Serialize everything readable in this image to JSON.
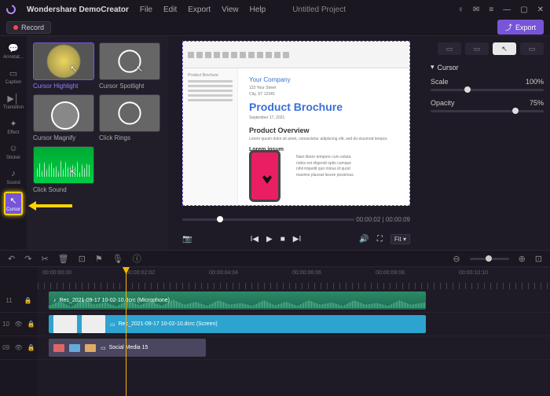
{
  "app": {
    "name": "Wondershare DemoCreator",
    "project": "Untitled Project"
  },
  "menus": [
    "File",
    "Edit",
    "Export",
    "View",
    "Help"
  ],
  "record_label": "Record",
  "export_label": "Export",
  "side_tabs": [
    {
      "label": "Annotat...",
      "icon": "💬"
    },
    {
      "label": "Caption",
      "icon": "▭"
    },
    {
      "label": "Transition",
      "icon": "▶▶"
    },
    {
      "label": "Effect",
      "icon": "✦"
    },
    {
      "label": "Sticker",
      "icon": "☺"
    },
    {
      "label": "Sound",
      "icon": "♪"
    },
    {
      "label": "Cursor",
      "icon": "↖"
    }
  ],
  "effects": [
    {
      "label": "Cursor Highlight",
      "selected": true
    },
    {
      "label": "Cursor Spotlight"
    },
    {
      "label": "Cursor Magnify"
    },
    {
      "label": "Click Rings"
    },
    {
      "label": "Click Sound"
    }
  ],
  "preview_doc": {
    "sidebar_title": "Product Brochure",
    "company": "Your Company",
    "title": "Product Brochure",
    "h2": "Product Overview",
    "lorem_heading": "Lorem ipsum"
  },
  "transport": {
    "current": "00:00:02",
    "total": "00:00:09",
    "fit": "Fit"
  },
  "props": {
    "section": "Cursor",
    "scale_label": "Scale",
    "scale_value": "100%",
    "opacity_label": "Opacity",
    "opacity_value": "75%"
  },
  "timeline": {
    "marks": [
      "00:00:00:00",
      "00:00:02:02",
      "00:00:04:04",
      "00:00:06:06",
      "00:00:08:08",
      "00:00:10:10"
    ],
    "tracks": [
      {
        "id": "11",
        "clip_label": "Rec_2021-09-17 10-02-10.dcrc (Microphone)"
      },
      {
        "id": "10",
        "clip_label": "Rec_2021-09-17 10-02-10.dcrc (Screen)"
      },
      {
        "id": "09",
        "clip_label": "Social Media 15"
      }
    ]
  }
}
